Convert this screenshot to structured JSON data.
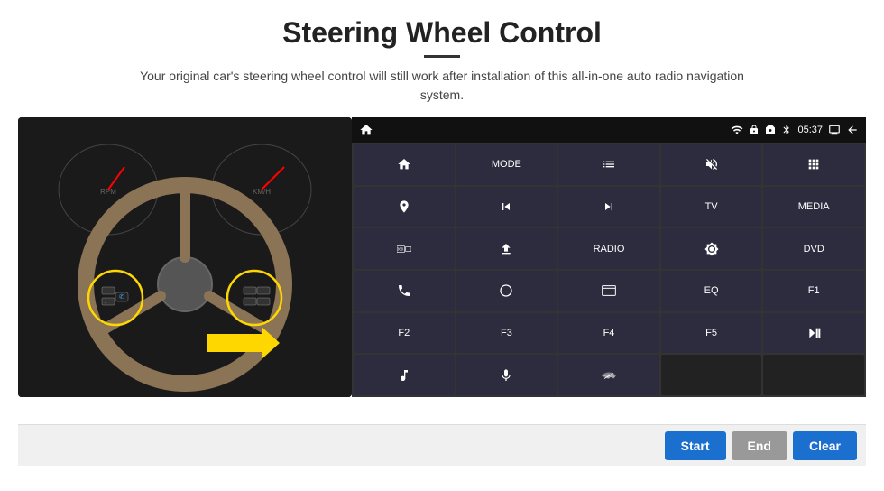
{
  "header": {
    "title": "Steering Wheel Control",
    "divider": true,
    "subtitle": "Your original car's steering wheel control will still work after installation of this all-in-one auto radio navigation system."
  },
  "statusBar": {
    "time": "05:37",
    "icons": [
      "wifi",
      "lock",
      "sim",
      "bluetooth",
      "screen",
      "back"
    ]
  },
  "buttonGrid": [
    {
      "id": "home",
      "type": "icon",
      "icon": "home"
    },
    {
      "id": "mode",
      "type": "text",
      "label": "MODE"
    },
    {
      "id": "list",
      "type": "icon",
      "icon": "list"
    },
    {
      "id": "mute",
      "type": "icon",
      "icon": "mute"
    },
    {
      "id": "apps",
      "type": "icon",
      "icon": "apps"
    },
    {
      "id": "nav",
      "type": "icon",
      "icon": "nav"
    },
    {
      "id": "prev",
      "type": "icon",
      "icon": "prev"
    },
    {
      "id": "next",
      "type": "icon",
      "icon": "next"
    },
    {
      "id": "tv",
      "type": "text",
      "label": "TV"
    },
    {
      "id": "media",
      "type": "text",
      "label": "MEDIA"
    },
    {
      "id": "360cam",
      "type": "icon",
      "icon": "360cam"
    },
    {
      "id": "eject",
      "type": "icon",
      "icon": "eject"
    },
    {
      "id": "radio",
      "type": "text",
      "label": "RADIO"
    },
    {
      "id": "brightness",
      "type": "icon",
      "icon": "brightness"
    },
    {
      "id": "dvd",
      "type": "text",
      "label": "DVD"
    },
    {
      "id": "phone",
      "type": "icon",
      "icon": "phone"
    },
    {
      "id": "swipe",
      "type": "icon",
      "icon": "swipe"
    },
    {
      "id": "window",
      "type": "icon",
      "icon": "window"
    },
    {
      "id": "eq",
      "type": "text",
      "label": "EQ"
    },
    {
      "id": "f1",
      "type": "text",
      "label": "F1"
    },
    {
      "id": "f2",
      "type": "text",
      "label": "F2"
    },
    {
      "id": "f3",
      "type": "text",
      "label": "F3"
    },
    {
      "id": "f4",
      "type": "text",
      "label": "F4"
    },
    {
      "id": "f5",
      "type": "text",
      "label": "F5"
    },
    {
      "id": "playpause",
      "type": "icon",
      "icon": "playpause"
    },
    {
      "id": "music",
      "type": "icon",
      "icon": "music"
    },
    {
      "id": "mic",
      "type": "icon",
      "icon": "mic"
    },
    {
      "id": "hangup",
      "type": "icon",
      "icon": "hangup"
    },
    {
      "id": "empty1",
      "type": "empty"
    },
    {
      "id": "empty2",
      "type": "empty"
    }
  ],
  "bottomBar": {
    "startLabel": "Start",
    "endLabel": "End",
    "clearLabel": "Clear"
  }
}
